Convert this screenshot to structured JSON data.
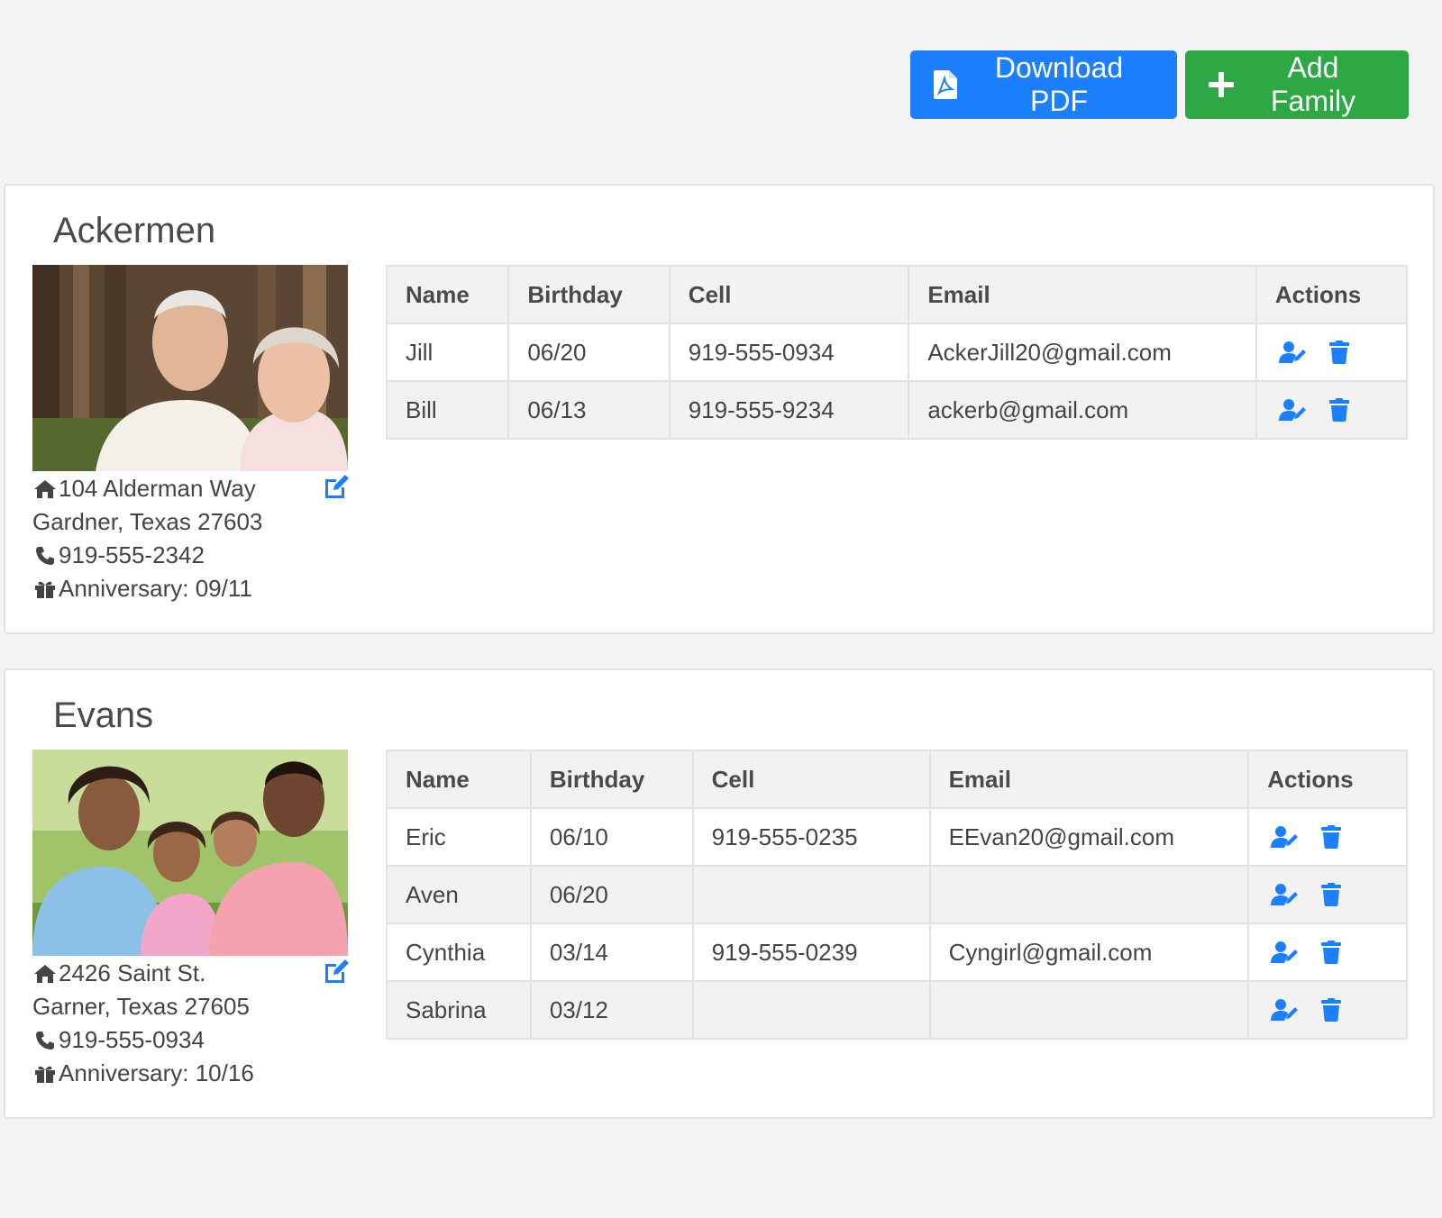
{
  "toolbar": {
    "download_label": "Download PDF",
    "add_label": "Add Family"
  },
  "colors": {
    "primary": "#1c7fff",
    "success": "#2ea745",
    "icon_blue": "#1c7fff"
  },
  "table_headers": [
    "Name",
    "Birthday",
    "Cell",
    "Email",
    "Actions"
  ],
  "families": [
    {
      "name": "Ackermen",
      "address_line1": "104 Alderman Way",
      "address_line2": "Gardner, Texas 27603",
      "phone": "919-555-2342",
      "anniversary": "Anniversary: 09/11",
      "members": [
        {
          "name": "Jill",
          "birthday": "06/20",
          "cell": "919-555-0934",
          "email": "AckerJill20@gmail.com"
        },
        {
          "name": "Bill",
          "birthday": "06/13",
          "cell": "919-555-9234",
          "email": "ackerb@gmail.com"
        }
      ]
    },
    {
      "name": "Evans",
      "address_line1": "2426 Saint St.",
      "address_line2": "Garner, Texas 27605",
      "phone": "919-555-0934",
      "anniversary": "Anniversary: 10/16",
      "members": [
        {
          "name": "Eric",
          "birthday": "06/10",
          "cell": "919-555-0235",
          "email": "EEvan20@gmail.com"
        },
        {
          "name": "Aven",
          "birthday": "06/20",
          "cell": "",
          "email": ""
        },
        {
          "name": "Cynthia",
          "birthday": "03/14",
          "cell": "919-555-0239",
          "email": "Cyngirl@gmail.com"
        },
        {
          "name": "Sabrina",
          "birthday": "03/12",
          "cell": "",
          "email": ""
        }
      ]
    }
  ],
  "icons": {
    "download": "file-pdf-icon",
    "add": "plus-icon",
    "edit_family": "edit-icon",
    "home": "home-icon",
    "phone": "phone-icon",
    "gift": "gift-icon",
    "edit_member": "user-edit-icon",
    "delete_member": "trash-icon"
  }
}
